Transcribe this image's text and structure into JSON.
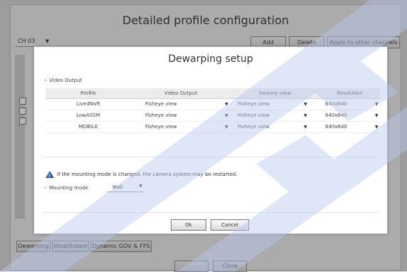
{
  "outer": {
    "title": "Detailed profile configuration",
    "channel": "CH 03",
    "buttons": {
      "add": "Add",
      "delete": "Delete",
      "apply": "Apply to other channels"
    },
    "tabs": [
      "Dewarping",
      "WiseStream",
      "Dynamic GOV & FPS"
    ],
    "close": "Close"
  },
  "modal": {
    "title": "Dewarping setup",
    "section": "Video Output",
    "columns": [
      "Profile",
      "Video Output",
      "Dewarp view",
      "Resolution"
    ],
    "rows": [
      {
        "profile": "Live4NVR",
        "video_output": "Fisheye view",
        "dewarp_view": "Fisheye view",
        "resolution": "640x640"
      },
      {
        "profile": "LowASSM",
        "video_output": "Fisheye view",
        "dewarp_view": "Fisheye view",
        "resolution": "640x640"
      },
      {
        "profile": "MOBILE",
        "video_output": "Fisheye view",
        "dewarp_view": "Fisheye view",
        "resolution": "640x640"
      }
    ],
    "warning": "If the mounting mode is changed, the camera system may be restarted.",
    "mounting_label": "Mounting mode",
    "mounting_value": "Wall",
    "ok": "Ok",
    "cancel": "Cancel"
  },
  "colors": {
    "accent": "#2f5fa8",
    "watermark": "#b8c8ee"
  }
}
